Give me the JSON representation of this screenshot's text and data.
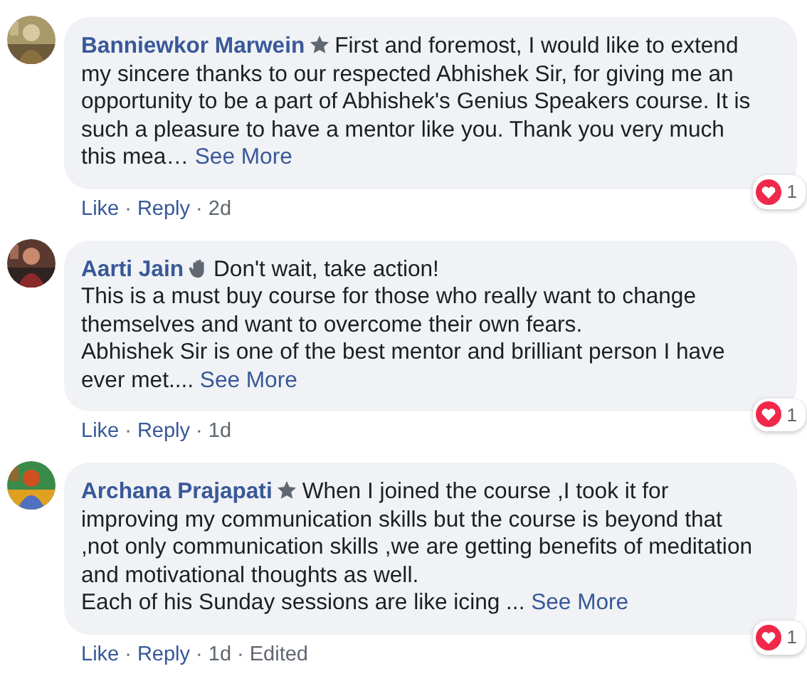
{
  "comments": [
    {
      "author": "Banniewkor Marwein",
      "badge": {
        "kind": "star"
      },
      "lines": [
        "First and foremost, I would like to extend",
        "my sincere thanks to our respected Abhishek Sir, for giving me an",
        "opportunity to be a part of Abhishek's Genius Speakers course. It is",
        "such a pleasure to have a mentor like you. Thank you very much",
        "this mea…"
      ],
      "see_more": "See More",
      "actions": [
        "Like",
        "·",
        "Reply",
        "·",
        "2d"
      ],
      "reactions": "1"
    },
    {
      "author": "Aarti Jain",
      "badge": {
        "kind": "wave"
      },
      "lines": [
        "Don't wait, take action!",
        "This is a must buy course for those who really want to change",
        "themselves and want to overcome their own fears.",
        "Abhishek Sir is one of the best mentor and brilliant person I have",
        "ever met...."
      ],
      "see_more": "See More",
      "actions": [
        "Like",
        "·",
        "Reply",
        "·",
        "1d"
      ],
      "reactions": "1"
    },
    {
      "author": "Archana Prajapati",
      "badge": {
        "kind": "star"
      },
      "lines": [
        "When I joined the course ,I took it for",
        "improving my communication skills but the course is beyond that",
        ",not only communication skills ,we are getting benefits of meditation",
        "and motivational thoughts as well.",
        "Each of his Sunday sessions are like icing ..."
      ],
      "see_more": "See More",
      "actions": [
        "Like",
        "·",
        "Reply",
        "·",
        "1d",
        "·",
        "Edited"
      ],
      "reactions": "1"
    }
  ]
}
